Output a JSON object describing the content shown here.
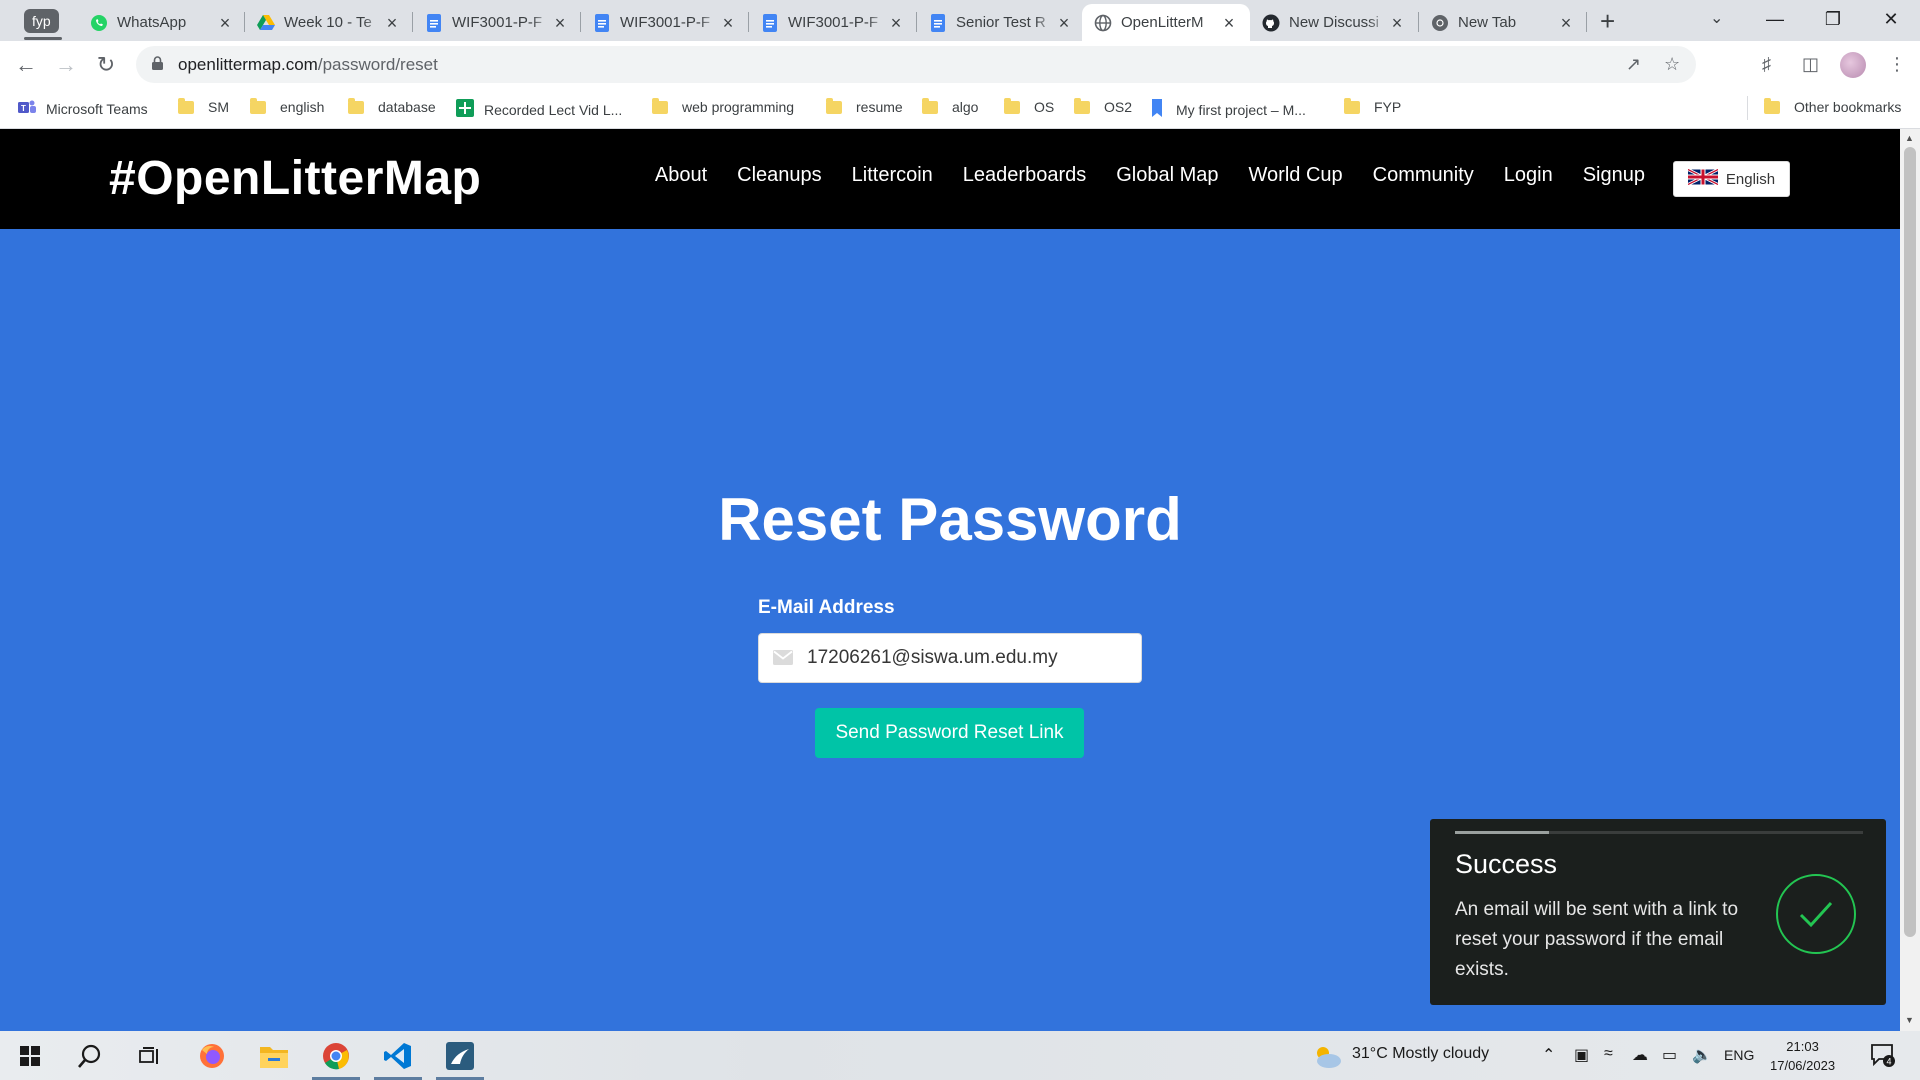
{
  "browser": {
    "tab_group": "fyp",
    "tabs": [
      {
        "label": "WhatsApp",
        "icon": "whatsapp-icon"
      },
      {
        "label": "Week 10 - Te",
        "icon": "google-drive-icon"
      },
      {
        "label": "WIF3001-P-F",
        "icon": "google-docs-icon"
      },
      {
        "label": "WIF3001-P-F",
        "icon": "google-docs-icon"
      },
      {
        "label": "WIF3001-P-F",
        "icon": "google-docs-icon"
      },
      {
        "label": "Senior Test R",
        "icon": "google-docs-icon"
      },
      {
        "label": "OpenLitterM",
        "icon": "globe-icon",
        "active": true
      },
      {
        "label": "New Discussi",
        "icon": "github-icon"
      },
      {
        "label": "New Tab",
        "icon": "chrome-icon"
      }
    ],
    "url_host": "openlittermap.com",
    "url_path": "/password/reset",
    "bookmarks": [
      "Microsoft Teams",
      "SM",
      "english",
      "database",
      "Recorded Lect Vid L...",
      "web programming",
      "resume",
      "algo",
      "OS",
      "OS2",
      "My first project – M...",
      "FYP"
    ],
    "other_bookmarks": "Other bookmarks"
  },
  "site": {
    "brand": "#OpenLitterMap",
    "nav": [
      "About",
      "Cleanups",
      "Littercoin",
      "Leaderboards",
      "Global Map",
      "World Cup",
      "Community",
      "Login",
      "Signup"
    ],
    "language": "English"
  },
  "form": {
    "title": "Reset Password",
    "email_label": "E-Mail Address",
    "email_value": "17206261@siswa.um.edu.my",
    "submit_label": "Send Password Reset Link"
  },
  "toast": {
    "title": "Success",
    "message": "An email will be sent with a link to reset your password if the email exists.",
    "progress": 0.23
  },
  "taskbar": {
    "weather": "31°C  Mostly cloudy",
    "lang": "ENG",
    "time": "21:03",
    "date": "17/06/2023",
    "notifications": "4"
  },
  "colors": {
    "page_bg": "#3273dc",
    "nav_bg": "#000000",
    "button": "#00c4a7",
    "toast_bg": "#1b1f1d",
    "success": "#23c552"
  }
}
